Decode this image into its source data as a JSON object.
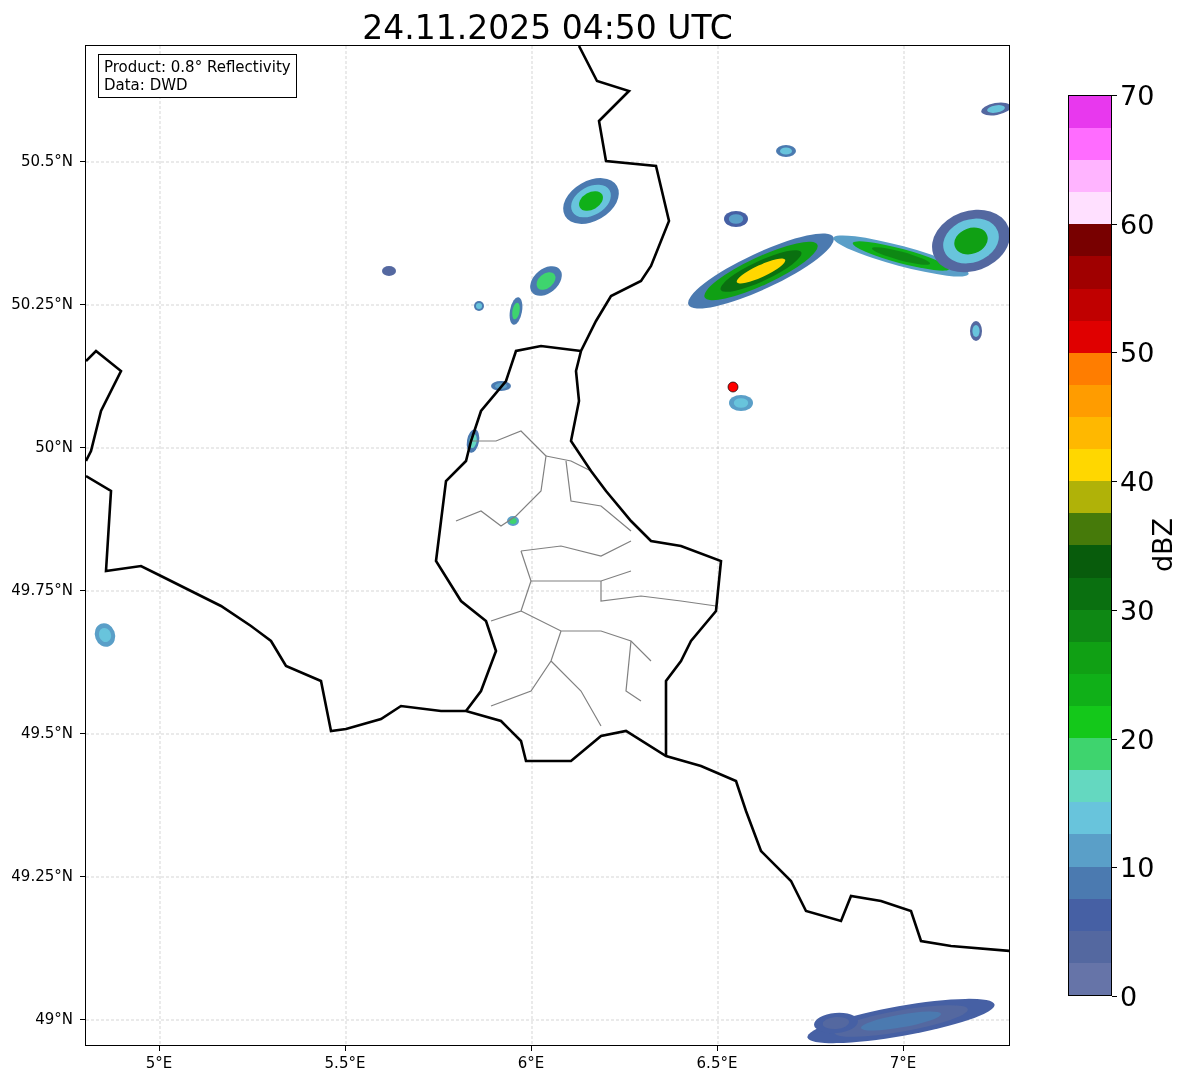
{
  "title": "24.11.2025 04:50 UTC",
  "info_box": {
    "lines": [
      "Product: 0.8° Reflectivity",
      "Data: DWD"
    ]
  },
  "map": {
    "xtick_labels": [
      "5°E",
      "5.5°E",
      "6°E",
      "6.5°E",
      "7°E"
    ],
    "ytick_labels": [
      "50.5°N",
      "50.25°N",
      "50°N",
      "49.75°N",
      "49.5°N",
      "49.25°N",
      "49°N"
    ]
  },
  "colorbar": {
    "label": "dBZ",
    "ticks": [
      "70",
      "60",
      "50",
      "40",
      "30",
      "20",
      "10",
      "0"
    ],
    "steps": [
      {
        "color": "#6674a8"
      },
      {
        "color": "#5468a0"
      },
      {
        "color": "#4660a4"
      },
      {
        "color": "#4b7ab0"
      },
      {
        "color": "#5a9fc8"
      },
      {
        "color": "#68c4dc"
      },
      {
        "color": "#64d8c0"
      },
      {
        "color": "#3ed46e"
      },
      {
        "color": "#14c81a"
      },
      {
        "color": "#10b018"
      },
      {
        "color": "#10a014"
      },
      {
        "color": "#0e8814"
      },
      {
        "color": "#0a7010"
      },
      {
        "color": "#085c0c"
      },
      {
        "color": "#467a0a"
      },
      {
        "color": "#b0b208"
      },
      {
        "color": "#ffd700"
      },
      {
        "color": "#ffb800"
      },
      {
        "color": "#ff9c00"
      },
      {
        "color": "#ff7d00"
      },
      {
        "color": "#e00000"
      },
      {
        "color": "#c00000"
      },
      {
        "color": "#a00000"
      },
      {
        "color": "#780000"
      },
      {
        "color": "#ffe0ff"
      },
      {
        "color": "#ffb4ff"
      },
      {
        "color": "#ff6cff"
      },
      {
        "color": "#e838ee"
      }
    ]
  }
}
